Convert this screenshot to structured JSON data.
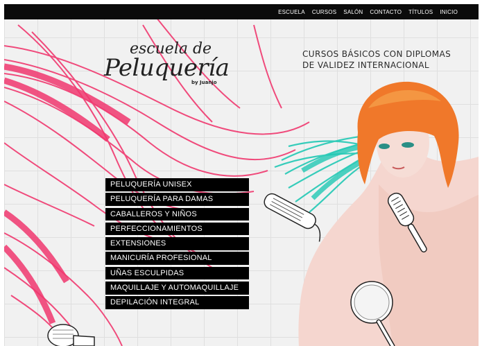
{
  "nav": {
    "items": [
      {
        "label": "ESCUELA"
      },
      {
        "label": "CURSOS"
      },
      {
        "label": "SALÓN"
      },
      {
        "label": "CONTACTO"
      },
      {
        "label": "TÍTULOS"
      },
      {
        "label": "INICIO"
      }
    ]
  },
  "logo": {
    "line1": "escuela de",
    "line2": "Peluquería",
    "line3": "by Juanjo"
  },
  "tagline": {
    "line1": "CURSOS BÁSICOS CON DIPLOMAS",
    "line2": "DE VALIDEZ INTERNACIONAL"
  },
  "menu": {
    "items": [
      {
        "label": "PELUQUERÍA UNISEX"
      },
      {
        "label": "PELUQUERÍA PARA DAMAS"
      },
      {
        "label": "CABALLEROS Y NIÑOS"
      },
      {
        "label": "PERFECCIONAMIENTOS"
      },
      {
        "label": "EXTENSIONES"
      },
      {
        "label": "MANICURÍA PROFESIONAL"
      },
      {
        "label": "UÑAS ESCULPIDAS"
      },
      {
        "label": "MAQUILLAJE Y AUTOMAQUILLAJE"
      },
      {
        "label": "DEPILACIÓN INTEGRAL"
      }
    ]
  },
  "colors": {
    "pink_hair": "#f0386f",
    "teal_hair": "#22c9b5",
    "orange_hair": "#f0782a",
    "menu_bg": "#000000"
  },
  "images": {
    "hero": "woman-with-orange-hair",
    "tools": [
      "flat-iron-icon",
      "hairbrush-icon",
      "hand-mirror-icon",
      "hair-dryer-icon"
    ]
  }
}
